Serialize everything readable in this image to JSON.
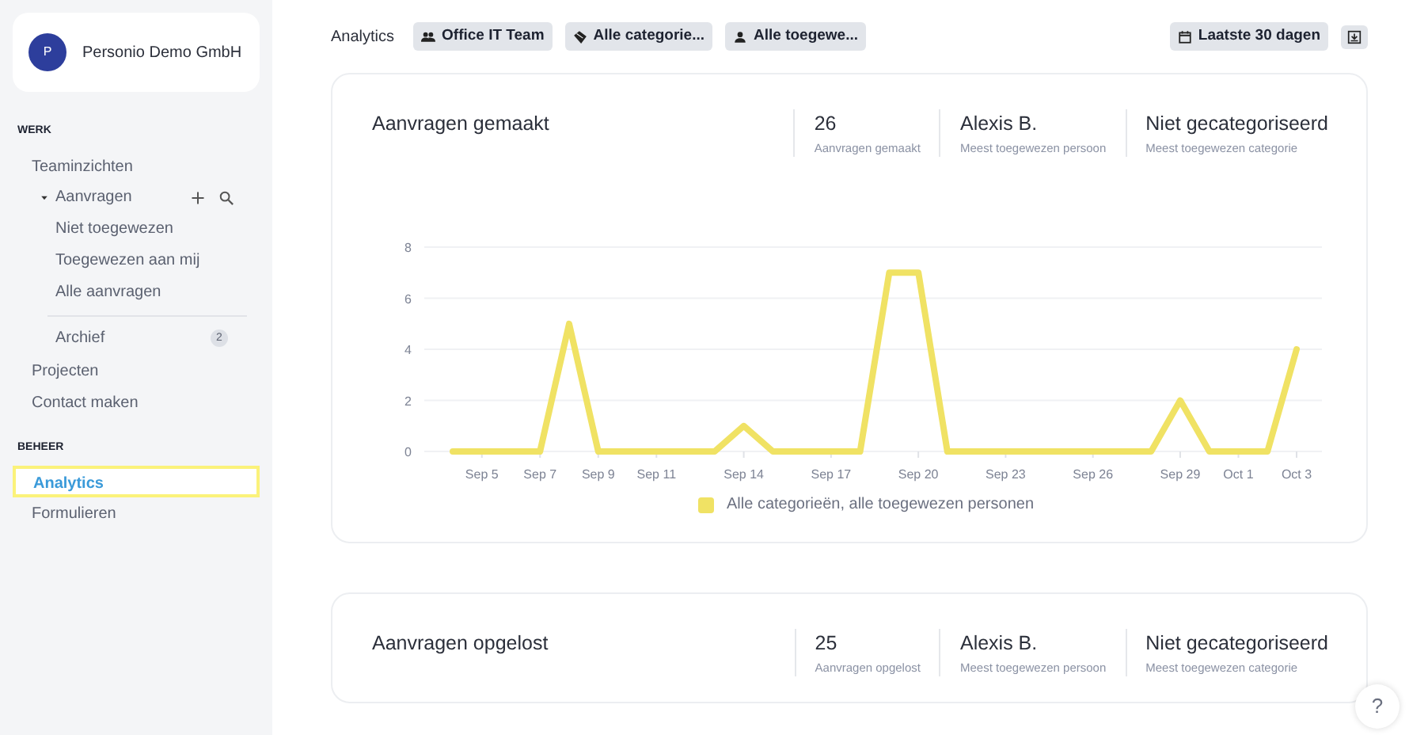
{
  "company": {
    "avatar": "P",
    "name": "Personio Demo GmbH"
  },
  "sidebar": {
    "sections": [
      {
        "heading": "WERK",
        "items": [
          {
            "label": "Teaminzichten",
            "selected": false
          },
          {
            "label": "Aanvragen",
            "selected": false,
            "expanded": true,
            "children": [
              {
                "label": "Niet toegewezen",
                "selected": false
              },
              {
                "label": "Toegewezen aan mij",
                "selected": false
              },
              {
                "label": "Alle aanvragen",
                "selected": false
              },
              {
                "label": "Archief",
                "selected": false,
                "count": "2"
              }
            ]
          },
          {
            "label": "Projecten",
            "selected": false
          },
          {
            "label": "Contact maken",
            "selected": false
          }
        ]
      },
      {
        "heading": "BEHEER",
        "items": [
          {
            "label": "Analytics",
            "selected": true
          },
          {
            "label": "Formulieren",
            "selected": false
          }
        ]
      }
    ]
  },
  "toolbar": {
    "title": "Analytics",
    "filters": [
      {
        "kind": "team",
        "label": "Office IT Team"
      },
      {
        "kind": "category",
        "label": "Alle categorie..."
      },
      {
        "kind": "person",
        "label": "Alle toegewe..."
      }
    ],
    "date_range": "Laatste 30 dagen"
  },
  "cards": [
    {
      "title": "Aanvragen gemaakt",
      "stats": [
        {
          "value": "26",
          "caption": "Aanvragen gemaakt"
        },
        {
          "value": "Alexis B.",
          "caption": "Meest toegewezen persoon"
        },
        {
          "value": "Niet gecategoriseerd",
          "caption": "Meest toegewezen categorie"
        }
      ],
      "chart_data": {
        "type": "line",
        "categories": [
          null,
          "Sep 5",
          null,
          "Sep 7",
          null,
          "Sep 9",
          null,
          "Sep 11",
          null,
          null,
          "Sep 14",
          null,
          null,
          "Sep 17",
          null,
          null,
          "Sep 20",
          null,
          null,
          "Sep 23",
          null,
          null,
          "Sep 26",
          null,
          null,
          "Sep 29",
          null,
          "Oct 1",
          null,
          "Oct 3"
        ],
        "yticks": [
          0,
          2,
          4,
          6,
          8
        ],
        "ylim": [
          0,
          8
        ],
        "grid": true,
        "series": [
          {
            "name": "Alle categorieën, alle toegewezen personen",
            "color": "#f0e264",
            "values": [
              0,
              0,
              0,
              0,
              5,
              0,
              0,
              0,
              0,
              0,
              1,
              0,
              0,
              0,
              0,
              7,
              7,
              0,
              0,
              0,
              0,
              0,
              0,
              0,
              0,
              2,
              0,
              0,
              0,
              4
            ]
          }
        ]
      }
    },
    {
      "title": "Aanvragen opgelost",
      "stats": [
        {
          "value": "25",
          "caption": "Aanvragen opgelost"
        },
        {
          "value": "Alexis B.",
          "caption": "Meest toegewezen persoon"
        },
        {
          "value": "Niet gecategoriseerd",
          "caption": "Meest toegewezen categorie"
        }
      ]
    }
  ],
  "help": "?"
}
